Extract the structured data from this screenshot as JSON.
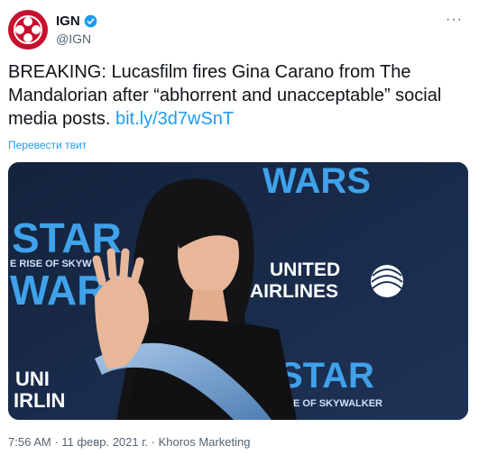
{
  "account": {
    "display_name": "IGN",
    "handle": "@IGN",
    "verified": true,
    "avatar_icon": "ign-logo-icon",
    "more_label": "···"
  },
  "tweet": {
    "text": "BREAKING: Lucasfilm fires Gina Carano from The Mandalorian after “abhorrent and unacceptable” social media posts.",
    "link": "bit.ly/3d7wSnT",
    "translate_label": "Перевести твит"
  },
  "media": {
    "backdrop": {
      "sw_top": "WARS",
      "sw_left_1": "STAR",
      "sw_left_sub": "E RISE OF SKYW",
      "sw_left_2": "WARS",
      "ua_1": "UNITED",
      "ua_2": "AIRLINES",
      "ua_small_1": "UNI",
      "ua_small_2": "IRLIN",
      "sw_bottom": "STAR",
      "sw_bottom_sub": "E OF SKYWALKER"
    }
  },
  "meta": {
    "time": "7:56 AM",
    "date": "11 февр. 2021 г.",
    "source": "Khoros Marketing",
    "separator": "·"
  },
  "colors": {
    "ign_red": "#c8102e",
    "link_blue": "#1d9bf0",
    "backdrop_navy": "#1a2a44"
  }
}
